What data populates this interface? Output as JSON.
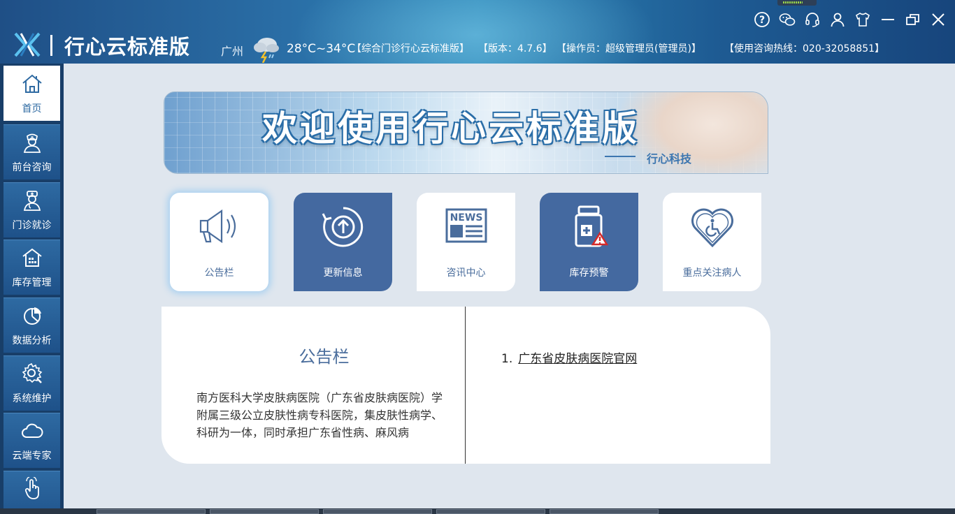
{
  "header": {
    "app_title": "行心云标准版",
    "city": "广州",
    "temperature": "28°C~34°C",
    "system_name": "【综合门诊行心云标准版】",
    "version": "【版本：4.7.6】",
    "operator": "【操作员：超级管理员(管理员)】",
    "hotline": "【使用咨询热线：020-32058851】",
    "icons": [
      "help-icon",
      "wechat-icon",
      "headset-icon",
      "user-icon",
      "tshirt-icon",
      "minimize-icon",
      "restore-icon",
      "close-icon"
    ]
  },
  "sidebar": {
    "items": [
      {
        "label": "首页",
        "icon": "home-icon"
      },
      {
        "label": "前台咨询",
        "icon": "nurse-icon"
      },
      {
        "label": "门诊就诊",
        "icon": "doctor-icon"
      },
      {
        "label": "库存管理",
        "icon": "warehouse-icon"
      },
      {
        "label": "数据分析",
        "icon": "pie-chart-icon"
      },
      {
        "label": "系统维护",
        "icon": "settings-icon"
      },
      {
        "label": "云端专家",
        "icon": "cloud-icon"
      },
      {
        "label": "",
        "icon": "hand-pointer-icon"
      }
    ]
  },
  "banner": {
    "title": "欢迎使用行心云标准版",
    "subtitle": "行心科技"
  },
  "tiles": [
    {
      "label": "公告栏",
      "icon": "megaphone-icon"
    },
    {
      "label": "更新信息",
      "icon": "update-icon"
    },
    {
      "label": "咨讯中心",
      "icon": "news-icon",
      "badge": "NEWS"
    },
    {
      "label": "库存预警",
      "icon": "medicine-warning-icon"
    },
    {
      "label": "重点关注病人",
      "icon": "heart-accessibility-icon"
    }
  ],
  "notice": {
    "title": "公告栏",
    "text": "南方医科大学皮肤病医院（广东省皮肤病医院）学附属三级公立皮肤性病专科医院，集皮肤性病学、科研为一体，同时承担广东省性病、麻风病"
  },
  "links": [
    {
      "index": "1.",
      "text": "广东省皮肤病医院官网"
    }
  ],
  "colors": {
    "header_blue": "#1f4f86",
    "tile_blue": "#4469a0",
    "accent_text": "#4a6d9c"
  }
}
